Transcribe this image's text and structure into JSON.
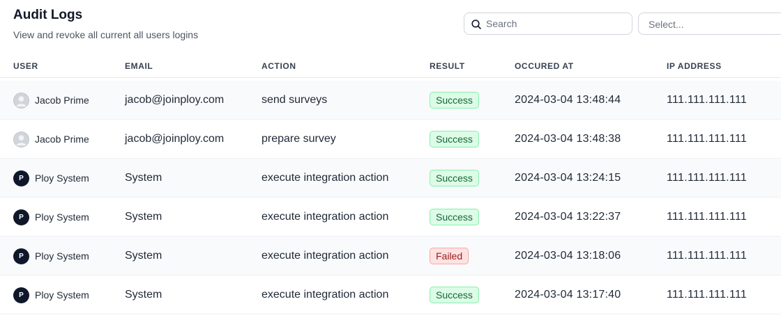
{
  "header": {
    "title": "Audit Logs",
    "subtitle": "View and revoke all current all users logins"
  },
  "toolbar": {
    "search_placeholder": "Search",
    "select_placeholder": "Select..."
  },
  "table": {
    "columns": [
      "USER",
      "EMAIL",
      "ACTION",
      "RESULT",
      "OCCURED AT",
      "IP ADDRESS"
    ],
    "rows": [
      {
        "user": "Jacob Prime",
        "avatar": "person",
        "avatar_letter": "",
        "email": "jacob@joinploy.com",
        "action": "send surveys",
        "result": "Success",
        "result_status": "success",
        "occurred_at": "2024-03-04 13:48:44",
        "ip": "111.111.111.111"
      },
      {
        "user": "Jacob Prime",
        "avatar": "person",
        "avatar_letter": "",
        "email": "jacob@joinploy.com",
        "action": "prepare survey",
        "result": "Success",
        "result_status": "success",
        "occurred_at": "2024-03-04 13:48:38",
        "ip": "111.111.111.111"
      },
      {
        "user": "Ploy System",
        "avatar": "system",
        "avatar_letter": "P",
        "email": "System",
        "action": "execute integration action",
        "result": "Success",
        "result_status": "success",
        "occurred_at": "2024-03-04 13:24:15",
        "ip": "111.111.111.111"
      },
      {
        "user": "Ploy System",
        "avatar": "system",
        "avatar_letter": "P",
        "email": "System",
        "action": "execute integration action",
        "result": "Success",
        "result_status": "success",
        "occurred_at": "2024-03-04 13:22:37",
        "ip": "111.111.111.111"
      },
      {
        "user": "Ploy System",
        "avatar": "system",
        "avatar_letter": "P",
        "email": "System",
        "action": "execute integration action",
        "result": "Failed",
        "result_status": "failed",
        "occurred_at": "2024-03-04 13:18:06",
        "ip": "111.111.111.111"
      },
      {
        "user": "Ploy System",
        "avatar": "system",
        "avatar_letter": "P",
        "email": "System",
        "action": "execute integration action",
        "result": "Success",
        "result_status": "success",
        "occurred_at": "2024-03-04 13:17:40",
        "ip": "111.111.111.111"
      }
    ]
  },
  "colors": {
    "success_bg": "#dcfce7",
    "success_text": "#166534",
    "failed_bg": "#fee2e2",
    "failed_text": "#991b1b",
    "system_avatar": "#0f172a"
  },
  "icons": {
    "search": "search-icon",
    "user_avatar": "user-avatar-icon"
  }
}
